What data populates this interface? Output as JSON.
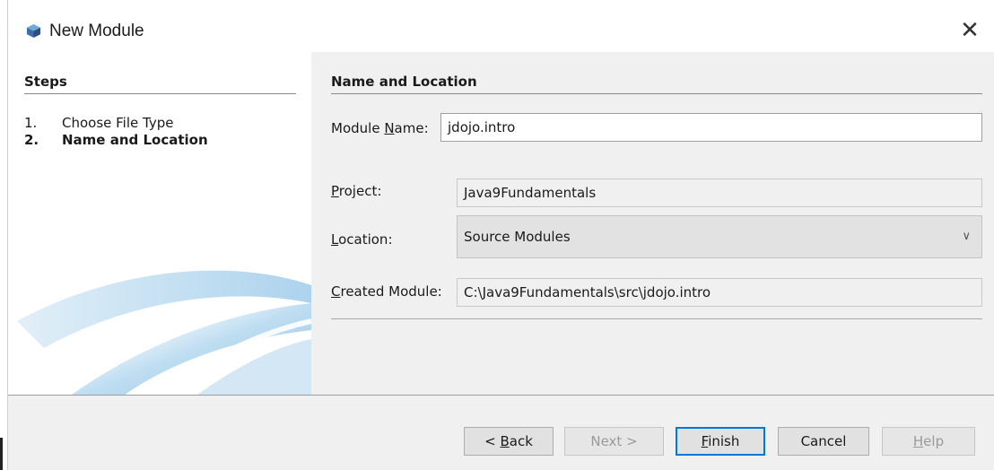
{
  "window": {
    "title": "New Module",
    "icon": "module-cube-icon",
    "close_glyph": "✕"
  },
  "steps": {
    "title": "Steps",
    "items": [
      {
        "number": "1.",
        "label": "Choose File Type",
        "current": false
      },
      {
        "number": "2.",
        "label": "Name and Location",
        "current": true
      }
    ]
  },
  "form": {
    "section_title": "Name and Location",
    "module_name": {
      "label_pre": "Module ",
      "mnemonic": "N",
      "label_post": "ame:",
      "value": "jdojo.intro"
    },
    "project": {
      "label_pre": "",
      "mnemonic": "P",
      "label_post": "roject:",
      "value": "Java9Fundamentals"
    },
    "location": {
      "label_pre": "",
      "mnemonic": "L",
      "label_post": "ocation:",
      "value": "Source Modules"
    },
    "created_module": {
      "label_pre": "",
      "mnemonic": "C",
      "label_post": "reated Module:",
      "value": "C:\\Java9Fundamentals\\src\\jdojo.intro"
    }
  },
  "buttons": {
    "back": {
      "pre": "< ",
      "mnemonic": "B",
      "post": "ack"
    },
    "next": {
      "label": "Next >"
    },
    "finish": {
      "pre": "",
      "mnemonic": "F",
      "post": "inish"
    },
    "cancel": {
      "label": "Cancel"
    },
    "help": {
      "pre": "",
      "mnemonic": "H",
      "post": "elp"
    }
  },
  "colors": {
    "dialog_bg": "#f0f0f0",
    "default_button_border": "#0078d7",
    "decoration_blue": "#8fc3e6"
  }
}
